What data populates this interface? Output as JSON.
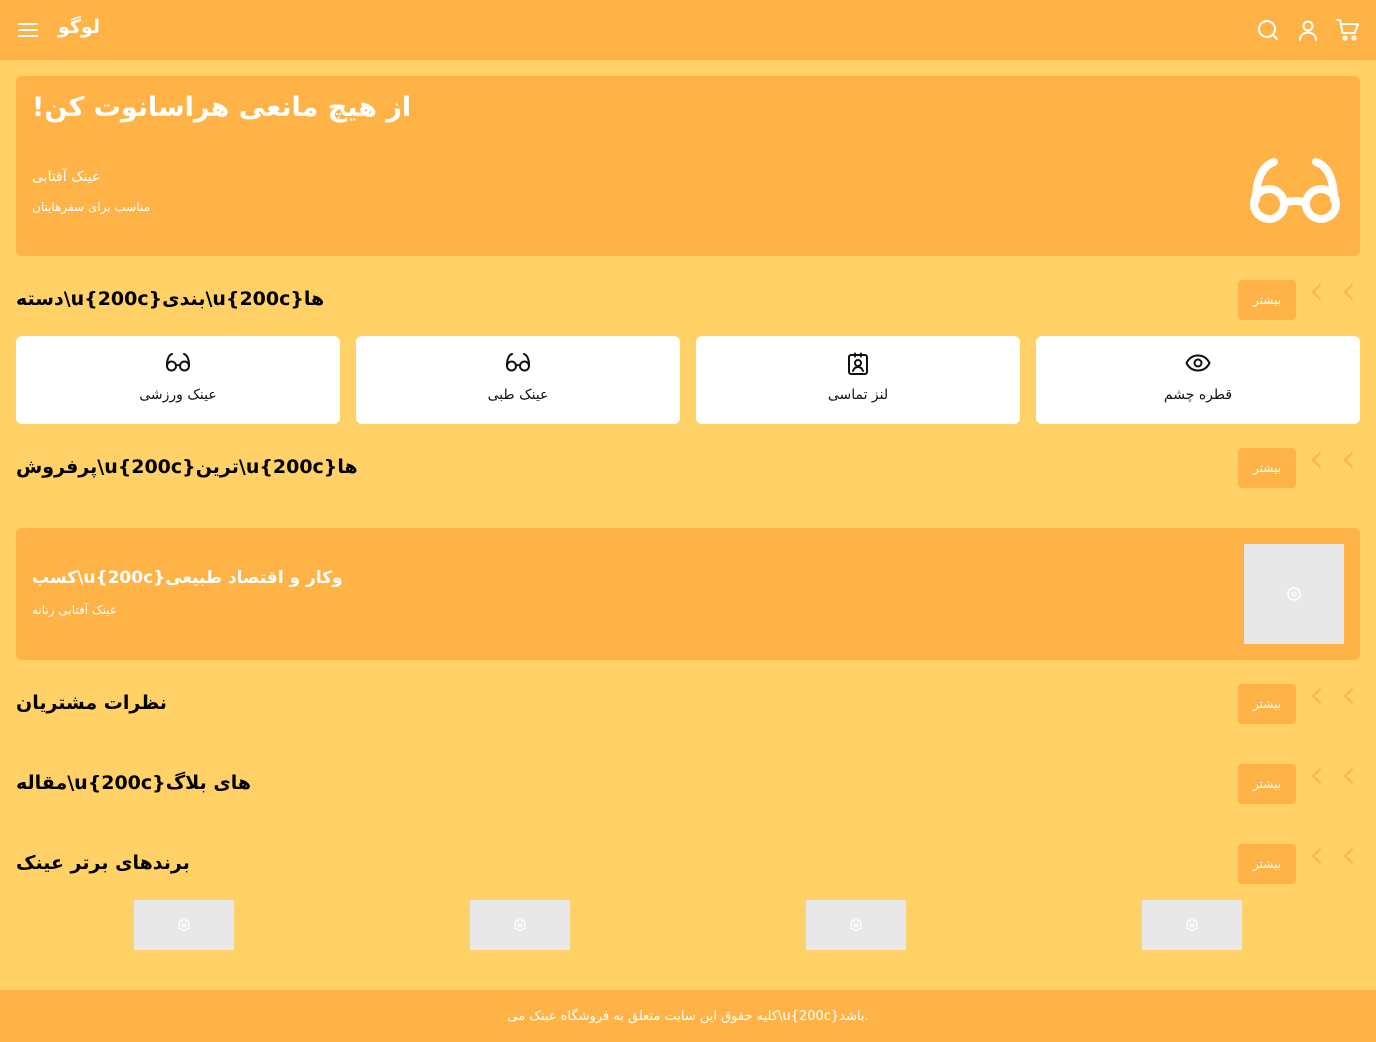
{
  "header": {
    "logo": "لوگو",
    "icons": [
      "menu-icon",
      "search-icon",
      "user-icon",
      "cart-icon"
    ]
  },
  "hero": {
    "title": "!از هیچ مانعی هراسانوت کن",
    "subtitle": "عینک آفتابی",
    "description": "مناسب برای سفرهایتان"
  },
  "sections": {
    "categories": {
      "title": "دسته\\u{200c}بندی\\u{200c}ها",
      "more": "بیشتر"
    },
    "bestsellers": {
      "title": "پرفروش\\u{200c}ترین\\u{200c}ها",
      "more": "بیشتر"
    },
    "reviews": {
      "title": "نظرات مشتریان",
      "more": "بیشتر"
    },
    "articles": {
      "title": "مقاله\\u{200c}های بلاگ",
      "more": "بیشتر"
    },
    "brands": {
      "title": "برندهای برتر عینک",
      "more": "بیشتر"
    }
  },
  "categories": [
    {
      "label": "عینک ورزشی",
      "icon": "glasses-icon"
    },
    {
      "label": "عینک طبی",
      "icon": "glasses-icon"
    },
    {
      "label": "لنز تماسی",
      "icon": "contact-card-icon"
    },
    {
      "label": "قطره چشم",
      "icon": "eye-icon"
    }
  ],
  "promo": {
    "title": "کسب\\u{200c}وکار و اقتصاد طبیعی",
    "subtitle": "عینک آفتابی زنانه"
  },
  "footer": {
    "text": "کلیه حقوق این سایت متعلق به فروشگاه عینک می\\u{200c}باشد."
  },
  "colors": {
    "background": "#FFD166",
    "accent": "#FFB347",
    "card": "#FFFFFF",
    "placeholder": "#E8E8E8"
  }
}
